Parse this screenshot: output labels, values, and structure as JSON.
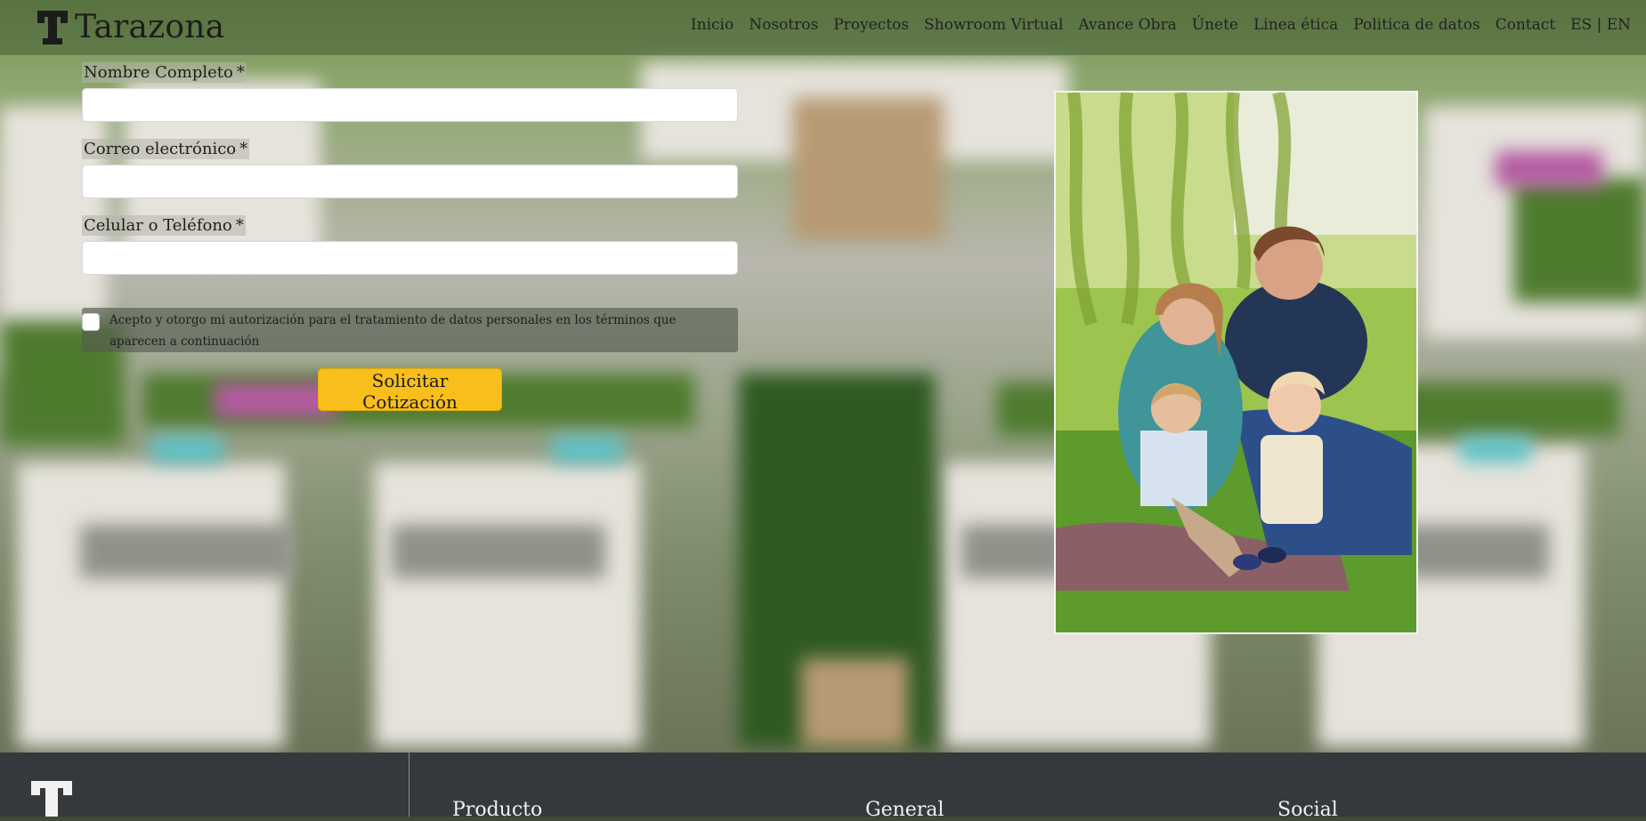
{
  "brand": {
    "name": "Tarazona"
  },
  "nav": {
    "items": [
      "Inicio",
      "Nosotros",
      "Proyectos",
      "Showroom Virtual",
      "Avance Obra",
      "Únete",
      "Linea ética",
      "Politica de datos",
      "Contact"
    ],
    "language": "ES | EN"
  },
  "form": {
    "name_label": "Nombre Completo",
    "email_label": "Correo electrónico",
    "phone_label": "Celular o Teléfono",
    "required_mark": "*",
    "consent_text": "Acepto y otorgo mi autorización para el tratamiento de datos personales en los términos que aparecen a continuación",
    "submit_label": "Solicitar Cotización"
  },
  "footer": {
    "columns": [
      "Producto",
      "General",
      "Social"
    ]
  },
  "colors": {
    "submit": "#f8bf1c",
    "footer": "#35393b"
  }
}
